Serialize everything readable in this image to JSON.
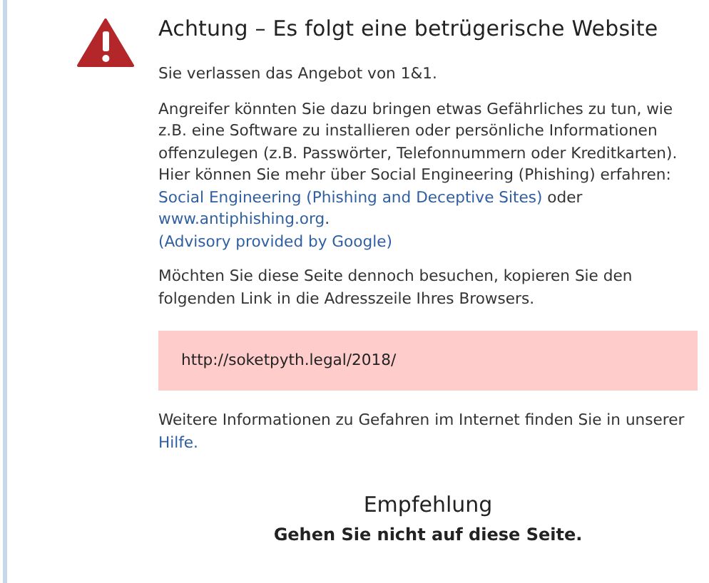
{
  "title": "Achtung – Es folgt eine betrügerische Website",
  "intro": "Sie verlassen das Angebot von 1&1.",
  "warning": [
    {
      "kind": "text",
      "text": "Angreifer könnten Sie dazu bringen etwas Gefährliches zu tun, wie z.B. eine Software zu installieren oder persönliche Informationen offenzulegen (z.B. Passwörter, Telefonnummern oder Kreditkarten). Hier können Sie mehr über Social Engineering (Phishing) erfahren: "
    },
    {
      "kind": "link",
      "text": "Social Engineering (Phishing and Deceptive Sites)"
    },
    {
      "kind": "text",
      "text": " oder "
    },
    {
      "kind": "link",
      "text": "www.antiphishing.org"
    },
    {
      "kind": "text",
      "text": "."
    }
  ],
  "advisory": "(Advisory provided by Google)",
  "continue_text": "Möchten Sie diese Seite dennoch besuchen, kopieren Sie den folgenden Link in die Adresszeile Ihres Browsers.",
  "url": "http://soketpyth.legal/2018/",
  "help": [
    {
      "kind": "text",
      "text": "Weitere Informationen zu Gefahren im Internet finden Sie in unserer "
    },
    {
      "kind": "link",
      "text": "Hilfe."
    }
  ],
  "recommendation": {
    "heading": "Empfehlung",
    "text": "Gehen Sie nicht auf diese Seite."
  }
}
